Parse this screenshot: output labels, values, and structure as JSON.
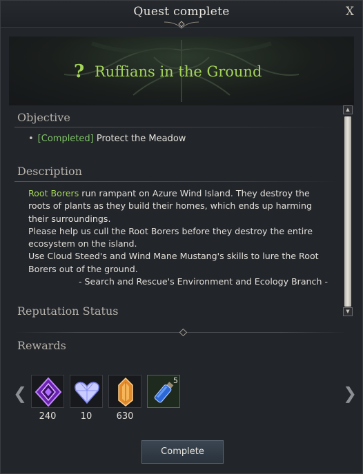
{
  "window": {
    "title": "Quest complete",
    "close_label": "X"
  },
  "quest": {
    "mark": "?",
    "title": "Ruffians in the Ground"
  },
  "objective": {
    "heading": "Objective",
    "items": [
      {
        "bullet": "•",
        "status": "[Completed]",
        "text": "Protect the Meadow"
      }
    ]
  },
  "description": {
    "heading": "Description",
    "highlight": "Root Borers",
    "line1_rest": " run rampant on Azure Wind Island. They destroy the roots of plants as they build their homes, which ends up harming their surroundings.",
    "line2": "Please help us cull the Root Borers before they destroy the entire ecosystem on the island.",
    "line3": "Use Cloud Steed's and Wind Mane Mustang's skills to lure the Root Borers out of the ground.",
    "signature": "- Search and Rescue's Environment and Ecology Branch -",
    "highlight_color": "#a4d45a"
  },
  "reputation": {
    "heading": "Reputation Status"
  },
  "rewards": {
    "heading": "Rewards",
    "items": [
      {
        "icon": "purple-gem-icon",
        "count": "240",
        "color": "#8b3ad8"
      },
      {
        "icon": "heart-crystal-icon",
        "count": "10",
        "color": "#9aa4ff"
      },
      {
        "icon": "amber-crystal-icon",
        "count": "630",
        "color": "#e08a2a"
      },
      {
        "icon": "potion-vial-icon",
        "badge": "5",
        "color": "#3f7fe0"
      }
    ],
    "prev_arrow": "❮",
    "next_arrow": "❯"
  },
  "actions": {
    "complete_label": "Complete"
  },
  "scrollbar": {
    "up": "▲",
    "down": "▼"
  }
}
